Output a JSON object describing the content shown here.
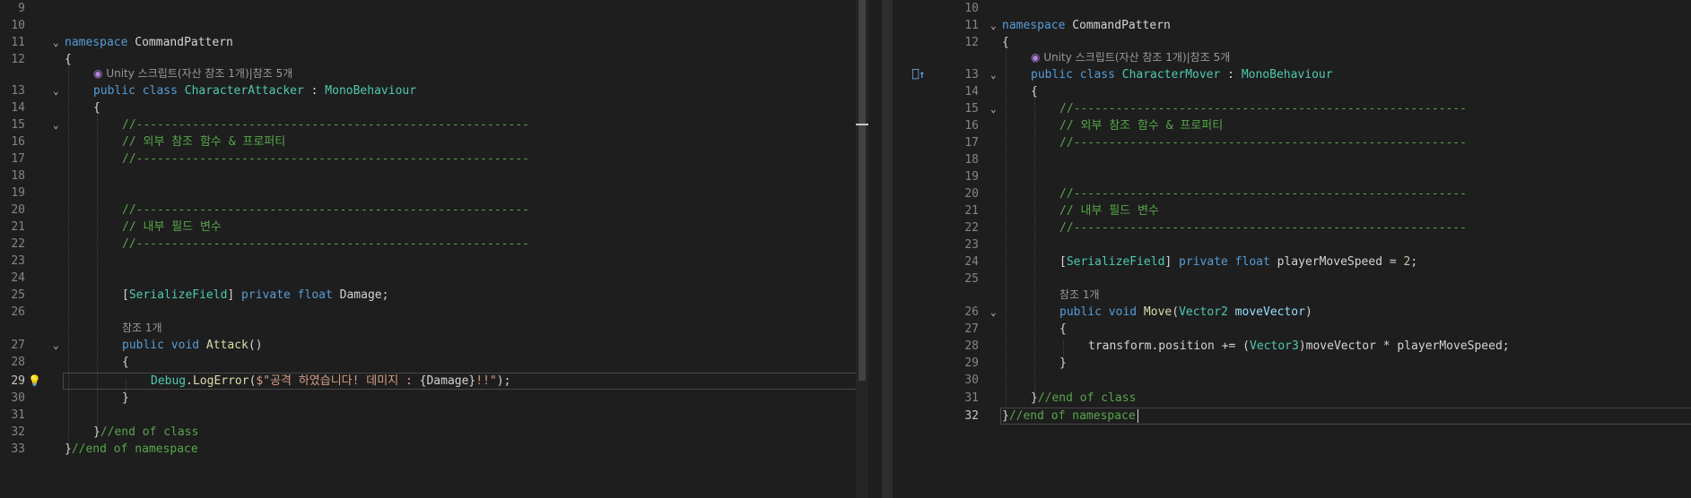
{
  "left_editor": {
    "current_line": "29",
    "codelens_class": "Unity 스크립트(자산 참조 1개)|참조 5개",
    "codelens_method": "참조 1개",
    "lines": [
      {
        "n": "9"
      },
      {
        "n": "10"
      },
      {
        "n": "11",
        "kw": "namespace",
        "name": " CommandPattern"
      },
      {
        "n": "12",
        "text": "{"
      },
      {
        "n": "13",
        "kw": "public class",
        "type_name": " CharacterAttacker",
        "sep": " : ",
        "base": "MonoBehaviour"
      },
      {
        "n": "14",
        "text": "{"
      },
      {
        "n": "15",
        "comment": "//--------------------------------------------------------"
      },
      {
        "n": "16",
        "comment": "// 외부 참조 함수 & 프로퍼티"
      },
      {
        "n": "17",
        "comment": "//--------------------------------------------------------"
      },
      {
        "n": "18"
      },
      {
        "n": "19"
      },
      {
        "n": "20",
        "comment": "//--------------------------------------------------------"
      },
      {
        "n": "21",
        "comment": "// 내부 필드 변수"
      },
      {
        "n": "22",
        "comment": "//--------------------------------------------------------"
      },
      {
        "n": "23"
      },
      {
        "n": "24"
      },
      {
        "n": "25",
        "open": "[",
        "attr": "SerializeField",
        "close": "]",
        "kw": " private float",
        "rest": " Damage;"
      },
      {
        "n": "26"
      },
      {
        "n": "27",
        "kw": "public void",
        "fn": " Attack",
        "rest": "()"
      },
      {
        "n": "28",
        "text": "{"
      },
      {
        "n": "29",
        "cls": "Debug",
        "dot": ".",
        "fn": "LogError",
        "p1": "(",
        "str1": "$\"공격 하였습니다! 데미지 : ",
        "interp": "{Damage}",
        "str2": "!!\"",
        "p2": ");"
      },
      {
        "n": "30",
        "text": "}"
      },
      {
        "n": "31"
      },
      {
        "n": "32",
        "text": "}",
        "comment": "//end of class"
      },
      {
        "n": "33",
        "text": "}",
        "comment": "//end of namespace"
      }
    ]
  },
  "right_editor": {
    "current_line": "32",
    "codelens_class": "Unity 스크립트(자산 참조 1개)|참조 5개",
    "codelens_method": "참조 1개",
    "gutter_marker": "⎕↑",
    "lines": [
      {
        "n": "10"
      },
      {
        "n": "11",
        "kw": "namespace",
        "name": " CommandPattern"
      },
      {
        "n": "12",
        "text": "{"
      },
      {
        "n": "13",
        "kw": "public class",
        "type_name": " CharacterMover",
        "sep": " : ",
        "base": "MonoBehaviour"
      },
      {
        "n": "14",
        "text": "{"
      },
      {
        "n": "15",
        "comment": "//--------------------------------------------------------"
      },
      {
        "n": "16",
        "comment": "// 외부 참조 함수 & 프로퍼티"
      },
      {
        "n": "17",
        "comment": "//--------------------------------------------------------"
      },
      {
        "n": "18"
      },
      {
        "n": "19"
      },
      {
        "n": "20",
        "comment": "//--------------------------------------------------------"
      },
      {
        "n": "21",
        "comment": "// 내부 필드 변수"
      },
      {
        "n": "22",
        "comment": "//--------------------------------------------------------"
      },
      {
        "n": "23"
      },
      {
        "n": "24",
        "open": "[",
        "attr": "SerializeField",
        "close": "]",
        "kw": " private float",
        "rest": " playerMoveSpeed = ",
        "num": "2",
        "end": ";"
      },
      {
        "n": "25"
      },
      {
        "n": "26",
        "kw": "public void",
        "fn": " Move",
        "p1": "(",
        "type_name": "Vector2",
        "param": " moveVector",
        "p2": ")"
      },
      {
        "n": "27",
        "text": "{"
      },
      {
        "n": "28",
        "text": "transform.position += (",
        "type_name": "Vector3",
        "rest": ")moveVector * playerMoveSpeed;"
      },
      {
        "n": "29",
        "text": "}"
      },
      {
        "n": "30"
      },
      {
        "n": "31",
        "text": "}",
        "comment": "//end of class"
      },
      {
        "n": "32",
        "text": "}",
        "comment": "//end of namespace"
      }
    ]
  }
}
